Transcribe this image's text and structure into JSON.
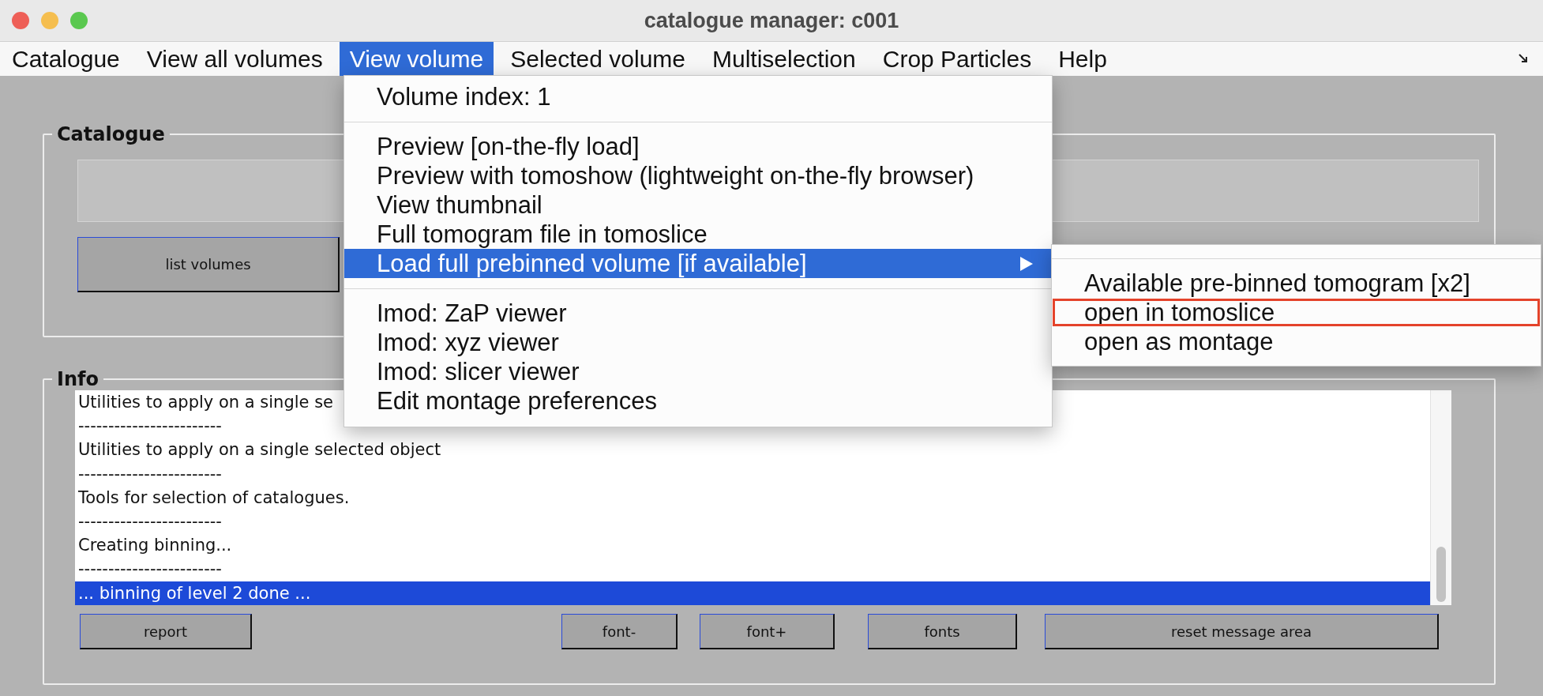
{
  "window": {
    "title": "catalogue manager: c001"
  },
  "menubar": [
    {
      "label": "Catalogue",
      "selected": false
    },
    {
      "label": "View all volumes",
      "selected": false
    },
    {
      "label": "View volume",
      "selected": true
    },
    {
      "label": "Selected volume",
      "selected": false
    },
    {
      "label": "Multiselection",
      "selected": false
    },
    {
      "label": "Crop Particles",
      "selected": false
    },
    {
      "label": "Help",
      "selected": false
    }
  ],
  "catalogue": {
    "title": "Catalogue",
    "buttons": [
      "list volumes"
    ]
  },
  "info": {
    "title": "Info",
    "lines": [
      {
        "text": "Utilities to apply on a single se",
        "selected": false
      },
      {
        "text": "------------------------",
        "selected": false
      },
      {
        "text": "Utilities to apply on a single selected object",
        "selected": false
      },
      {
        "text": "------------------------",
        "selected": false
      },
      {
        "text": "Tools for selection of catalogues.",
        "selected": false
      },
      {
        "text": "------------------------",
        "selected": false
      },
      {
        "text": "Creating binning...",
        "selected": false
      },
      {
        "text": "------------------------",
        "selected": false
      },
      {
        "text": "... binning of level 2 done ...",
        "selected": true
      }
    ],
    "buttons": [
      "report",
      "font-",
      "font+",
      "fonts",
      "reset message area"
    ]
  },
  "view_volume_menu": {
    "items": [
      {
        "kind": "header",
        "label": "Volume index: 1"
      },
      {
        "kind": "separator"
      },
      {
        "kind": "item",
        "label": "Preview [on-the-fly load]",
        "selected": false,
        "has_submenu": false
      },
      {
        "kind": "item",
        "label": "Preview with tomoshow (lightweight on-the-fly browser)",
        "selected": false,
        "has_submenu": false
      },
      {
        "kind": "item",
        "label": "View thumbnail",
        "selected": false,
        "has_submenu": false
      },
      {
        "kind": "item",
        "label": "Full tomogram file in tomoslice",
        "selected": false,
        "has_submenu": false
      },
      {
        "kind": "item",
        "label": "Load full prebinned volume [if available]",
        "selected": true,
        "has_submenu": true
      },
      {
        "kind": "separator"
      },
      {
        "kind": "item",
        "label": "Imod: ZaP viewer",
        "selected": false,
        "has_submenu": false
      },
      {
        "kind": "item",
        "label": "Imod: xyz viewer",
        "selected": false,
        "has_submenu": false
      },
      {
        "kind": "item",
        "label": "Imod: slicer viewer",
        "selected": false,
        "has_submenu": false
      },
      {
        "kind": "item",
        "label": "Edit montage preferences",
        "selected": false,
        "has_submenu": false
      }
    ]
  },
  "submenu": {
    "items": [
      {
        "kind": "separator"
      },
      {
        "kind": "item",
        "label": "Available pre-binned tomogram [x2]",
        "selected": false,
        "annotated": false
      },
      {
        "kind": "item",
        "label": "open in tomoslice",
        "selected": false,
        "annotated": true
      },
      {
        "kind": "item",
        "label": "open as montage",
        "selected": false,
        "annotated": false
      }
    ]
  }
}
